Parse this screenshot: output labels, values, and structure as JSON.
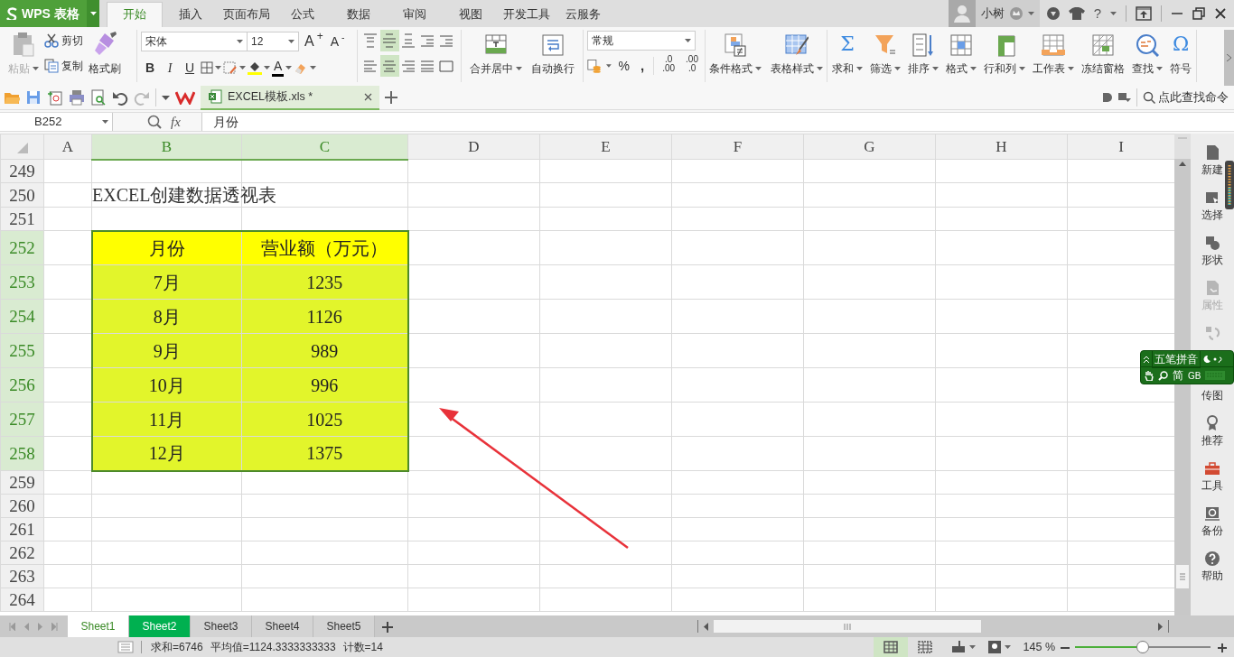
{
  "app": {
    "name": "WPS 表格"
  },
  "menu_tabs": [
    {
      "label": "开始",
      "selected": true
    },
    {
      "label": "插入",
      "selected": false
    },
    {
      "label": "页面布局",
      "selected": false
    },
    {
      "label": "公式",
      "selected": false
    },
    {
      "label": "数据",
      "selected": false
    },
    {
      "label": "审阅",
      "selected": false
    },
    {
      "label": "视图",
      "selected": false
    },
    {
      "label": "开发工具",
      "selected": false
    },
    {
      "label": "云服务",
      "selected": false
    }
  ],
  "account": {
    "user": "小树",
    "help": "?"
  },
  "ribbon": {
    "paste": {
      "label": "粘贴",
      "disabled": true
    },
    "cut": {
      "label": "剪切"
    },
    "copy": {
      "label": "复制"
    },
    "format_painter": {
      "label": "格式刷"
    },
    "font_name": "宋体",
    "font_size": "12",
    "grow_font": "A$^{+}$",
    "shrink_font": "A$^{-}$",
    "styles": [
      "B",
      "I",
      "U"
    ],
    "font_color": "A",
    "align_buttons": [
      {
        "selected": false
      },
      {
        "selected": true
      },
      {
        "selected": false
      },
      {
        "selected": false
      },
      {
        "selected": false
      },
      {
        "selected": false
      },
      {
        "selected": true
      },
      {
        "selected": false
      },
      {
        "selected": false
      },
      {
        "selected": false
      }
    ],
    "number_format": "常规",
    "percent": "%",
    "comma": ",",
    "decimals": [
      [
        ".0",
        ".00"
      ],
      [
        ".00",
        ".0"
      ]
    ],
    "tool_groups": [
      {
        "items": [
          {
            "label": "合并居中",
            "dropdown": true
          },
          {
            "label": "自动换行",
            "dropdown": false
          }
        ]
      },
      {
        "items": [
          {
            "label": "条件格式",
            "dropdown": true
          },
          {
            "label": "表格样式",
            "dropdown": true
          }
        ]
      },
      {
        "items": [
          {
            "label": "求和",
            "dropdown": true,
            "glyph": "Σ"
          },
          {
            "label": "筛选",
            "dropdown": true
          },
          {
            "label": "排序",
            "dropdown": true
          },
          {
            "label": "格式",
            "dropdown": true
          },
          {
            "label": "行和列",
            "dropdown": true
          },
          {
            "label": "工作表",
            "dropdown": true
          },
          {
            "label": "冻结窗格",
            "dropdown": false
          },
          {
            "label": "查找",
            "dropdown": true
          },
          {
            "label": "符号",
            "dropdown": false,
            "glyph": "Ω"
          }
        ]
      }
    ]
  },
  "document_tab": {
    "title": "EXCEL模板.xls *",
    "selected": true
  },
  "command_search": {
    "placeholder": "点此查找命令"
  },
  "formula_bar": {
    "cell": "B252",
    "fx": "fx",
    "value": "月份"
  },
  "columns": [
    {
      "label": "A",
      "selected": false
    },
    {
      "label": "B",
      "selected": true
    },
    {
      "label": "C",
      "selected": true
    },
    {
      "label": "D",
      "selected": false
    },
    {
      "label": "E",
      "selected": false
    },
    {
      "label": "F",
      "selected": false
    },
    {
      "label": "G",
      "selected": false
    },
    {
      "label": "H",
      "selected": false
    },
    {
      "label": "I",
      "selected": false
    }
  ],
  "rows": [
    {
      "number": "249",
      "selected": false,
      "kind": "blank"
    },
    {
      "number": "250",
      "selected": false,
      "kind": "title",
      "b": "EXCEL创建数据透视表"
    },
    {
      "number": "251",
      "selected": false,
      "kind": "blank"
    },
    {
      "number": "252",
      "selected": true,
      "kind": "header",
      "b": "月份",
      "c": "营业额（万元）"
    },
    {
      "number": "253",
      "selected": true,
      "kind": "data",
      "b": "7月",
      "c": "1235"
    },
    {
      "number": "254",
      "selected": true,
      "kind": "data",
      "b": "8月",
      "c": "1126"
    },
    {
      "number": "255",
      "selected": true,
      "kind": "data",
      "b": "9月",
      "c": "989"
    },
    {
      "number": "256",
      "selected": true,
      "kind": "data",
      "b": "10月",
      "c": "996"
    },
    {
      "number": "257",
      "selected": true,
      "kind": "data",
      "b": "11月",
      "c": "1025"
    },
    {
      "number": "258",
      "selected": true,
      "kind": "data",
      "b": "12月",
      "c": "1375"
    },
    {
      "number": "259",
      "selected": false,
      "kind": "blank"
    },
    {
      "number": "260",
      "selected": false,
      "kind": "blank"
    },
    {
      "number": "261",
      "selected": false,
      "kind": "blank"
    },
    {
      "number": "262",
      "selected": false,
      "kind": "blank"
    },
    {
      "number": "263",
      "selected": false,
      "kind": "blank"
    },
    {
      "number": "264",
      "selected": false,
      "kind": "blank"
    }
  ],
  "sidebar": [
    {
      "label": "新建",
      "disabled": false
    },
    {
      "label": "选择",
      "disabled": false
    },
    {
      "label": "形状",
      "disabled": false
    },
    {
      "label": "属性",
      "disabled": true
    },
    {
      "disabled": true
    },
    {
      "label": "传图",
      "disabled": false
    },
    {
      "label": "推荐",
      "disabled": false
    },
    {
      "label": "工具",
      "disabled": false
    },
    {
      "label": "备份",
      "disabled": false
    },
    {
      "label": "帮助",
      "disabled": false
    }
  ],
  "ime": {
    "mode": "五笔拼音",
    "charset": "简",
    "encoding": "GB"
  },
  "sheets": [
    {
      "label": "Sheet1",
      "selected": true
    },
    {
      "label": "Sheet2",
      "selected": false,
      "color": "#00b050"
    },
    {
      "label": "Sheet3",
      "selected": false
    },
    {
      "label": "Sheet4",
      "selected": false
    },
    {
      "label": "Sheet5",
      "selected": false
    }
  ],
  "status_bar": {
    "items": [
      "求和=6746",
      "平均值=1124.3333333333",
      "计数=14"
    ],
    "view_buttons": [
      {
        "selected": true
      },
      {
        "selected": false
      }
    ],
    "zoom": "145 %",
    "zoom_slider": {
      "level": 0.5
    }
  }
}
